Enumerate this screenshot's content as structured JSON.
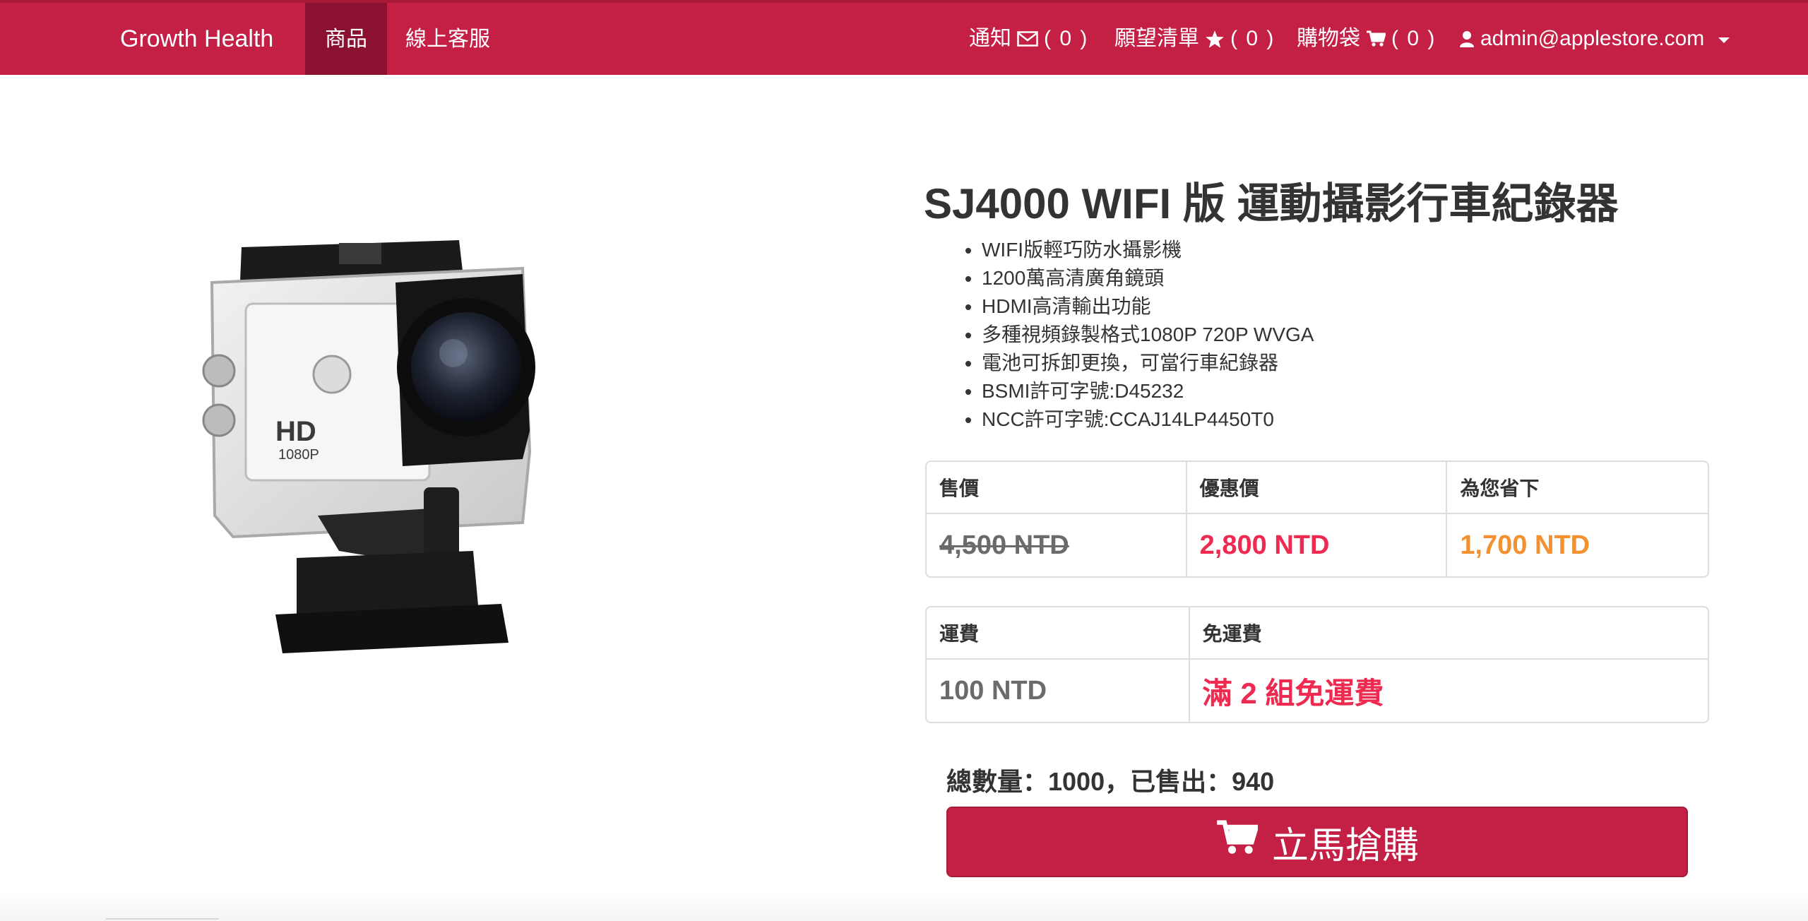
{
  "navbar": {
    "brand": "Growth Health",
    "products": "商品",
    "support": "線上客服",
    "notifications_label": "通知",
    "notifications_count": "( 0 )",
    "wishlist_label": "願望清單",
    "wishlist_count": "( 0 )",
    "cart_label": "購物袋",
    "cart_count": "( 0 )",
    "user": "admin@applestore.com",
    "icons": {
      "notifications": "envelope-icon",
      "wishlist": "star-icon",
      "cart": "cart-icon",
      "user": "user-icon"
    },
    "color": "#c41f44"
  },
  "product": {
    "image_text": "HD",
    "image_subtext": "1080P",
    "title": "SJ4000 WIFI 版 運動攝影行車紀錄器",
    "features": [
      "WIFI版輕巧防水攝影機",
      "1200萬高清廣角鏡頭",
      "HDMI高清輸出功能",
      "多種視頻錄製格式1080P 720P WVGA",
      "電池可拆卸更換，可當行車紀錄器",
      "BSMI許可字號:D45232",
      "NCC許可字號:CCAJ14LP4450T0"
    ]
  },
  "pricing": {
    "price_label": "售價",
    "discount_label": "優惠價",
    "saving_label": "為您省下",
    "price": "4,500 NTD",
    "discount": "2,800 NTD",
    "saving": "1,700 NTD"
  },
  "shipping": {
    "fee_label": "運費",
    "free_label": "免運費",
    "fee": "100 NTD",
    "free_rule": "滿 2 組免運費"
  },
  "stock": {
    "text": "總數量：1000，已售出：940"
  },
  "buy": {
    "label": "立馬搶購",
    "icon": "cart-icon"
  }
}
